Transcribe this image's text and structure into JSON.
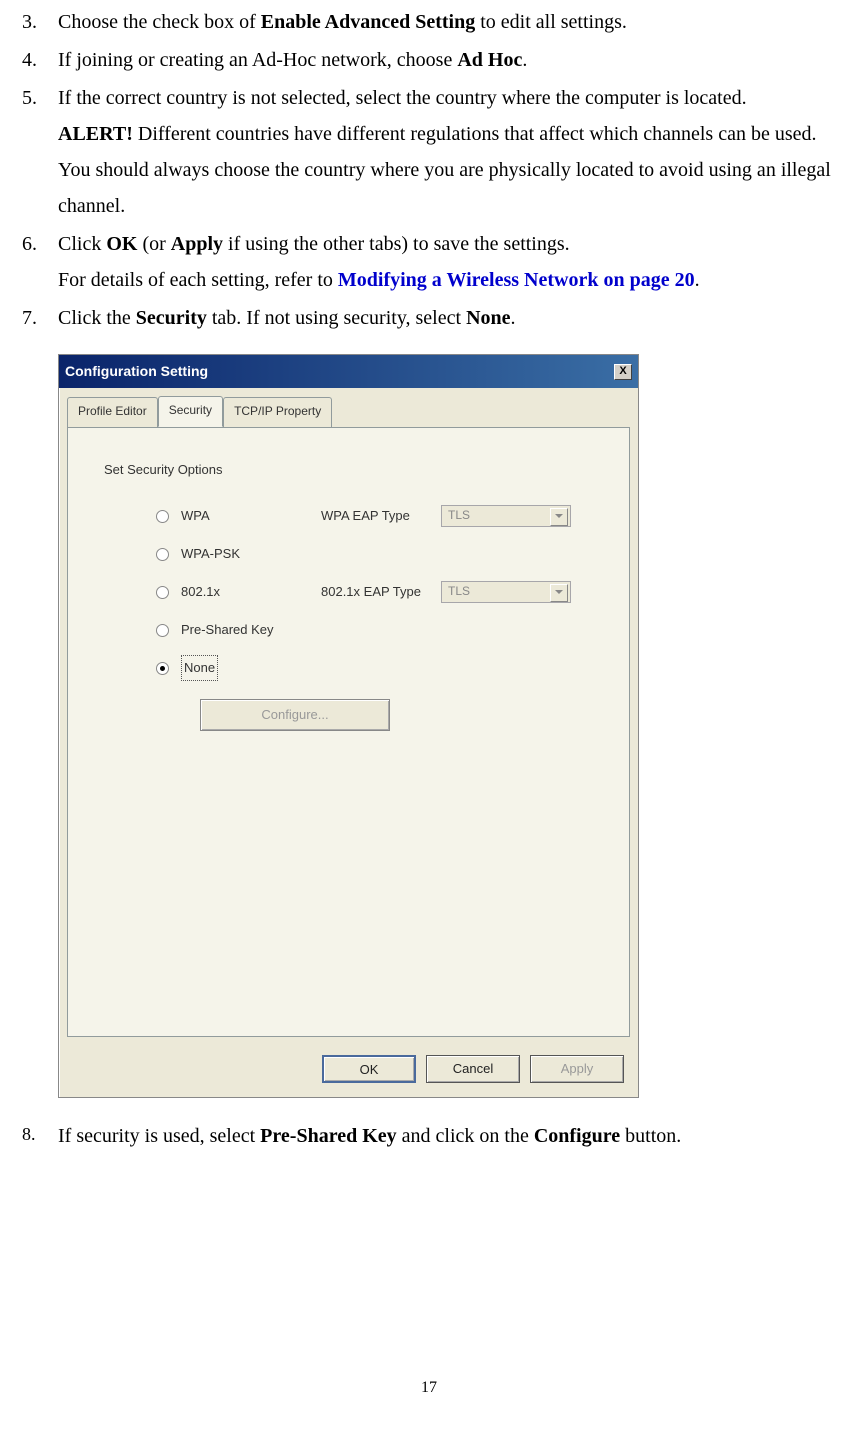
{
  "items": {
    "i3": {
      "num": "3.",
      "pre": "Choose the check box of ",
      "b1": "Enable Advanced Setting",
      "post": " to edit all settings."
    },
    "i4": {
      "num": "4.",
      "pre": "If joining or creating an Ad-Hoc network, choose ",
      "b1": "Ad Hoc",
      "post": "."
    },
    "i5": {
      "num": "5.",
      "text": "If the correct country is not selected, select the country where the computer is located.",
      "alert_b": "ALERT!",
      "alert_rest": " Different countries have different regulations that affect which channels can be used. You should always choose the country where you are physically located to avoid using an illegal channel."
    },
    "i6": {
      "num": "6.",
      "p1a": "Click ",
      "p1b1": "OK",
      "p1mid": " (or ",
      "p1b2": "Apply",
      "p1c": " if using the other tabs) to save the settings.",
      "p2a": "For details of each setting, refer to ",
      "p2link": "Modifying a Wireless Network on page 20",
      "p2c": "."
    },
    "i7": {
      "num": "7.",
      "a": "Click the ",
      "b1": "Security",
      "mid": " tab. If not using security, select ",
      "b2": "None",
      "c": "."
    },
    "i8": {
      "num": "8.",
      "a": "If security is used, select ",
      "b1": "Pre-Shared Key",
      "mid": " and click on the ",
      "b2": "Configure",
      "c": " button."
    }
  },
  "dialog": {
    "title": "Configuration Setting",
    "close": "X",
    "tabs": {
      "t1": "Profile Editor",
      "t2": "Security",
      "t3": "TCP/IP Property"
    },
    "group": "Set Security Options",
    "opts": {
      "wpa": "WPA",
      "wpa_eap": "WPA EAP Type",
      "wpapsk": "WPA-PSK",
      "dot1x": "802.1x",
      "dot1x_eap": "802.1x EAP Type",
      "psk": "Pre-Shared Key",
      "none": "None",
      "tls": "TLS"
    },
    "configure": "Configure...",
    "ok": "OK",
    "cancel": "Cancel",
    "apply": "Apply"
  },
  "page": "17"
}
